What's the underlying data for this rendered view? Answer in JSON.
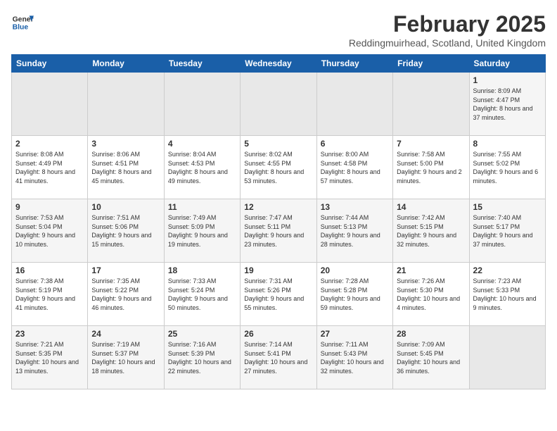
{
  "header": {
    "logo_line1": "General",
    "logo_line2": "Blue",
    "month_year": "February 2025",
    "location": "Reddingmuirhead, Scotland, United Kingdom"
  },
  "days_of_week": [
    "Sunday",
    "Monday",
    "Tuesday",
    "Wednesday",
    "Thursday",
    "Friday",
    "Saturday"
  ],
  "weeks": [
    [
      {
        "day": "",
        "empty": true
      },
      {
        "day": "",
        "empty": true
      },
      {
        "day": "",
        "empty": true
      },
      {
        "day": "",
        "empty": true
      },
      {
        "day": "",
        "empty": true
      },
      {
        "day": "",
        "empty": true
      },
      {
        "day": "1",
        "sunrise": "8:09 AM",
        "sunset": "4:47 PM",
        "daylight": "8 hours and 37 minutes."
      }
    ],
    [
      {
        "day": "2",
        "sunrise": "8:08 AM",
        "sunset": "4:49 PM",
        "daylight": "8 hours and 41 minutes."
      },
      {
        "day": "3",
        "sunrise": "8:06 AM",
        "sunset": "4:51 PM",
        "daylight": "8 hours and 45 minutes."
      },
      {
        "day": "4",
        "sunrise": "8:04 AM",
        "sunset": "4:53 PM",
        "daylight": "8 hours and 49 minutes."
      },
      {
        "day": "5",
        "sunrise": "8:02 AM",
        "sunset": "4:55 PM",
        "daylight": "8 hours and 53 minutes."
      },
      {
        "day": "6",
        "sunrise": "8:00 AM",
        "sunset": "4:58 PM",
        "daylight": "8 hours and 57 minutes."
      },
      {
        "day": "7",
        "sunrise": "7:58 AM",
        "sunset": "5:00 PM",
        "daylight": "9 hours and 2 minutes."
      },
      {
        "day": "8",
        "sunrise": "7:55 AM",
        "sunset": "5:02 PM",
        "daylight": "9 hours and 6 minutes."
      }
    ],
    [
      {
        "day": "9",
        "sunrise": "7:53 AM",
        "sunset": "5:04 PM",
        "daylight": "9 hours and 10 minutes."
      },
      {
        "day": "10",
        "sunrise": "7:51 AM",
        "sunset": "5:06 PM",
        "daylight": "9 hours and 15 minutes."
      },
      {
        "day": "11",
        "sunrise": "7:49 AM",
        "sunset": "5:09 PM",
        "daylight": "9 hours and 19 minutes."
      },
      {
        "day": "12",
        "sunrise": "7:47 AM",
        "sunset": "5:11 PM",
        "daylight": "9 hours and 23 minutes."
      },
      {
        "day": "13",
        "sunrise": "7:44 AM",
        "sunset": "5:13 PM",
        "daylight": "9 hours and 28 minutes."
      },
      {
        "day": "14",
        "sunrise": "7:42 AM",
        "sunset": "5:15 PM",
        "daylight": "9 hours and 32 minutes."
      },
      {
        "day": "15",
        "sunrise": "7:40 AM",
        "sunset": "5:17 PM",
        "daylight": "9 hours and 37 minutes."
      }
    ],
    [
      {
        "day": "16",
        "sunrise": "7:38 AM",
        "sunset": "5:19 PM",
        "daylight": "9 hours and 41 minutes."
      },
      {
        "day": "17",
        "sunrise": "7:35 AM",
        "sunset": "5:22 PM",
        "daylight": "9 hours and 46 minutes."
      },
      {
        "day": "18",
        "sunrise": "7:33 AM",
        "sunset": "5:24 PM",
        "daylight": "9 hours and 50 minutes."
      },
      {
        "day": "19",
        "sunrise": "7:31 AM",
        "sunset": "5:26 PM",
        "daylight": "9 hours and 55 minutes."
      },
      {
        "day": "20",
        "sunrise": "7:28 AM",
        "sunset": "5:28 PM",
        "daylight": "9 hours and 59 minutes."
      },
      {
        "day": "21",
        "sunrise": "7:26 AM",
        "sunset": "5:30 PM",
        "daylight": "10 hours and 4 minutes."
      },
      {
        "day": "22",
        "sunrise": "7:23 AM",
        "sunset": "5:33 PM",
        "daylight": "10 hours and 9 minutes."
      }
    ],
    [
      {
        "day": "23",
        "sunrise": "7:21 AM",
        "sunset": "5:35 PM",
        "daylight": "10 hours and 13 minutes."
      },
      {
        "day": "24",
        "sunrise": "7:19 AM",
        "sunset": "5:37 PM",
        "daylight": "10 hours and 18 minutes."
      },
      {
        "day": "25",
        "sunrise": "7:16 AM",
        "sunset": "5:39 PM",
        "daylight": "10 hours and 22 minutes."
      },
      {
        "day": "26",
        "sunrise": "7:14 AM",
        "sunset": "5:41 PM",
        "daylight": "10 hours and 27 minutes."
      },
      {
        "day": "27",
        "sunrise": "7:11 AM",
        "sunset": "5:43 PM",
        "daylight": "10 hours and 32 minutes."
      },
      {
        "day": "28",
        "sunrise": "7:09 AM",
        "sunset": "5:45 PM",
        "daylight": "10 hours and 36 minutes."
      },
      {
        "day": "",
        "empty": true
      }
    ]
  ]
}
